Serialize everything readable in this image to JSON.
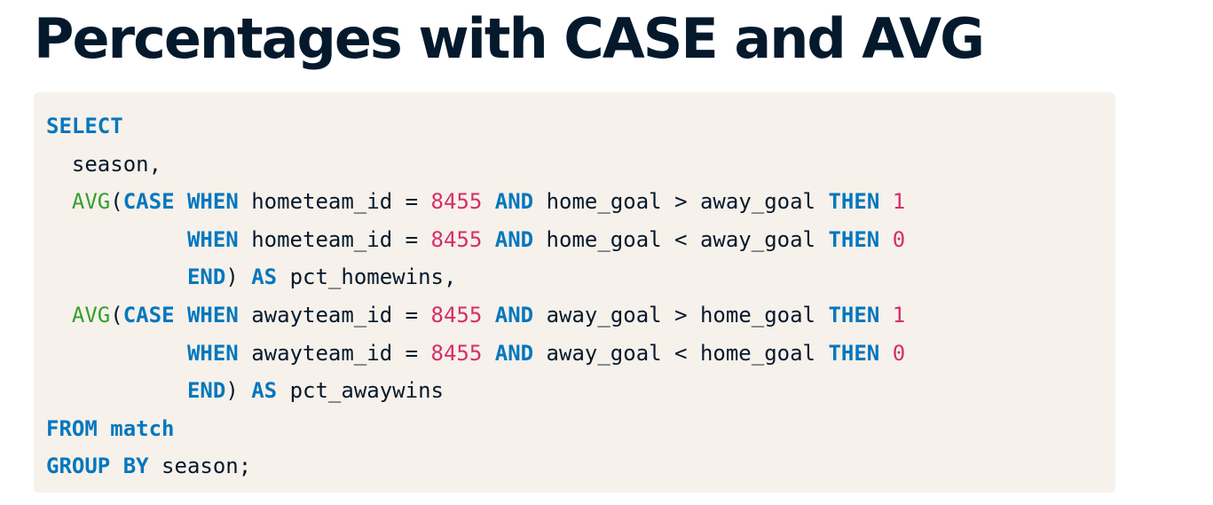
{
  "title": "Percentages with CASE and AVG",
  "colors": {
    "title": "#05192d",
    "code_background": "#f6f1ea",
    "keyword": "#0477bf",
    "function": "#33a02c",
    "number": "#d62e6b",
    "text": "#05192d"
  },
  "code": {
    "language": "sql",
    "lines": [
      [
        {
          "t": "kw",
          "v": "SELECT"
        }
      ],
      [
        {
          "t": "txt",
          "v": "  season,"
        }
      ],
      [
        {
          "t": "txt",
          "v": "  "
        },
        {
          "t": "fn",
          "v": "AVG"
        },
        {
          "t": "txt",
          "v": "("
        },
        {
          "t": "kw",
          "v": "CASE"
        },
        {
          "t": "txt",
          "v": " "
        },
        {
          "t": "kw",
          "v": "WHEN"
        },
        {
          "t": "txt",
          "v": " hometeam_id = "
        },
        {
          "t": "num",
          "v": "8455"
        },
        {
          "t": "txt",
          "v": " "
        },
        {
          "t": "kw",
          "v": "AND"
        },
        {
          "t": "txt",
          "v": " home_goal > away_goal "
        },
        {
          "t": "kw",
          "v": "THEN"
        },
        {
          "t": "txt",
          "v": " "
        },
        {
          "t": "num",
          "v": "1"
        }
      ],
      [
        {
          "t": "txt",
          "v": "           "
        },
        {
          "t": "kw",
          "v": "WHEN"
        },
        {
          "t": "txt",
          "v": " hometeam_id = "
        },
        {
          "t": "num",
          "v": "8455"
        },
        {
          "t": "txt",
          "v": " "
        },
        {
          "t": "kw",
          "v": "AND"
        },
        {
          "t": "txt",
          "v": " home_goal < away_goal "
        },
        {
          "t": "kw",
          "v": "THEN"
        },
        {
          "t": "txt",
          "v": " "
        },
        {
          "t": "num",
          "v": "0"
        }
      ],
      [
        {
          "t": "txt",
          "v": "           "
        },
        {
          "t": "kw",
          "v": "END"
        },
        {
          "t": "txt",
          "v": ") "
        },
        {
          "t": "kw",
          "v": "AS"
        },
        {
          "t": "txt",
          "v": " pct_homewins,"
        }
      ],
      [
        {
          "t": "txt",
          "v": "  "
        },
        {
          "t": "fn",
          "v": "AVG"
        },
        {
          "t": "txt",
          "v": "("
        },
        {
          "t": "kw",
          "v": "CASE"
        },
        {
          "t": "txt",
          "v": " "
        },
        {
          "t": "kw",
          "v": "WHEN"
        },
        {
          "t": "txt",
          "v": " awayteam_id = "
        },
        {
          "t": "num",
          "v": "8455"
        },
        {
          "t": "txt",
          "v": " "
        },
        {
          "t": "kw",
          "v": "AND"
        },
        {
          "t": "txt",
          "v": " away_goal > home_goal "
        },
        {
          "t": "kw",
          "v": "THEN"
        },
        {
          "t": "txt",
          "v": " "
        },
        {
          "t": "num",
          "v": "1"
        }
      ],
      [
        {
          "t": "txt",
          "v": "           "
        },
        {
          "t": "kw",
          "v": "WHEN"
        },
        {
          "t": "txt",
          "v": " awayteam_id = "
        },
        {
          "t": "num",
          "v": "8455"
        },
        {
          "t": "txt",
          "v": " "
        },
        {
          "t": "kw",
          "v": "AND"
        },
        {
          "t": "txt",
          "v": " away_goal < home_goal "
        },
        {
          "t": "kw",
          "v": "THEN"
        },
        {
          "t": "txt",
          "v": " "
        },
        {
          "t": "num",
          "v": "0"
        }
      ],
      [
        {
          "t": "txt",
          "v": "           "
        },
        {
          "t": "kw",
          "v": "END"
        },
        {
          "t": "txt",
          "v": ") "
        },
        {
          "t": "kw",
          "v": "AS"
        },
        {
          "t": "txt",
          "v": " pct_awaywins"
        }
      ],
      [
        {
          "t": "kw",
          "v": "FROM match"
        }
      ],
      [
        {
          "t": "kw",
          "v": "GROUP BY"
        },
        {
          "t": "txt",
          "v": " season;"
        }
      ]
    ]
  }
}
